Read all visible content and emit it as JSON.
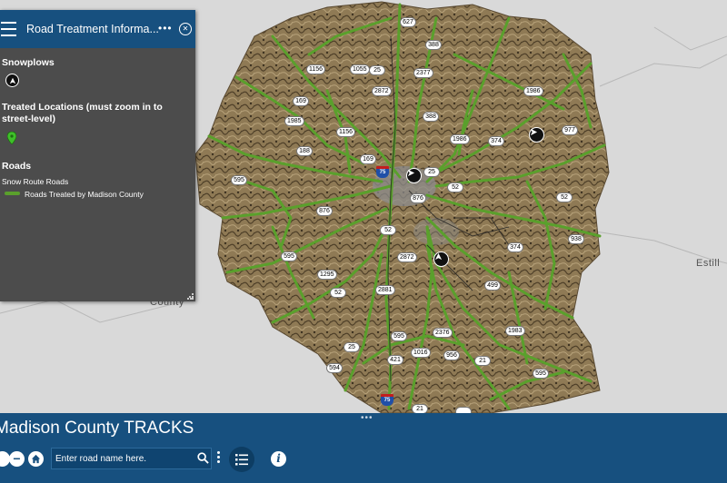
{
  "panel": {
    "title": "Road Treatment Informa...",
    "more": "•••",
    "close": "✕",
    "snowplows_heading": "Snowplows",
    "treated_heading": "Treated Locations (must zoom in to street-level)",
    "roads_heading": "Roads",
    "snow_route_label": "Snow Route Roads",
    "treated_roads_label": "Roads Treated by Madison County",
    "road_color": "#5aa02c"
  },
  "map": {
    "place_labels": [
      "Estill",
      "County"
    ],
    "route_shields": [
      "627",
      "388",
      "1156",
      "1055",
      "25",
      "2377",
      "2872",
      "1986",
      "169",
      "1985",
      "388",
      "1986",
      "374",
      "977",
      "1156",
      "188",
      "169",
      "25",
      "595",
      "876",
      "52",
      "52",
      "876",
      "52",
      "374",
      "938",
      "595",
      "2872",
      "1295",
      "52",
      "2881",
      "499",
      "2376",
      "1983",
      "595",
      "25",
      "1016",
      "956",
      "421",
      "21",
      "594",
      "595",
      "21"
    ],
    "interstate_labels": [
      "75",
      "75"
    ]
  },
  "bottom": {
    "app_title": "Madison County TRACKS",
    "grip": "•••",
    "search_placeholder": "Enter road name here.",
    "zoom_out_label": "−",
    "info_label": "i"
  }
}
